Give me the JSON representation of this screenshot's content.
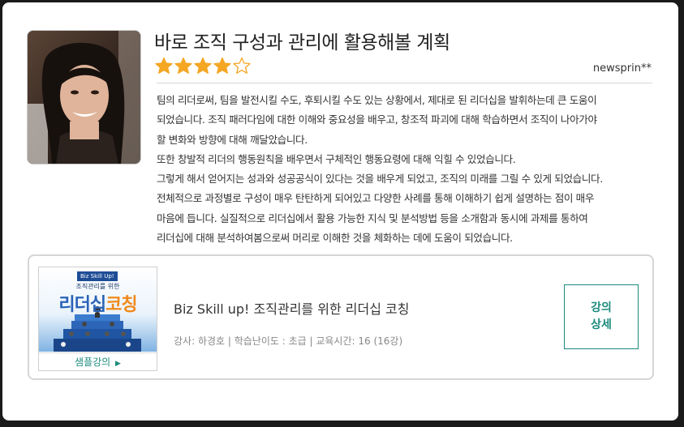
{
  "review": {
    "title": "바로 조직 구성과 관리에 활용해볼 계획",
    "rating": 4,
    "rating_max": 5,
    "author": "newsprin**",
    "paragraphs": [
      "팀의 리더로써, 팀을 발전시킬 수도, 후퇴시킬 수도 있는 상황에서, 제대로 된 리더십을 발휘하는데 큰 도움이",
      "되었습니다. 조직 패러다임에 대한 이해와 중요성을 배우고, 창조적 파괴에 대해 학습하면서 조직이 나아가야",
      "할 변화와 방향에 대해 깨달았습니다.",
      "또한 창발적 리더의 행동원칙을 배우면서 구체적인 행동요령에 대해 익힐 수 있었습니다.",
      "그렇게 해서 얻어지는 성과와 성공공식이 있다는 것을 배우게 되었고, 조직의 미래를 그릴 수 있게 되었습니다.",
      "전체적으로 과정별로 구성이 매우 탄탄하게 되어있고 다양한 사례를 통해 이해하기 쉽게 설명하는 점이 매우",
      "마음에 듭니다. 실질적으로 리더십에서 활용 가능한 지식 및 분석방법 등을 소개함과 동시에 과제를 통하여",
      "리더십에 대해 분석하여봄으로써 머리로 이해한 것을 체화하는 데에 도움이 되었습니다."
    ]
  },
  "course": {
    "thumb_badge": "Biz Skill Up!",
    "thumb_subtitle": "조직관리를 위한",
    "thumb_title_a": "리더십",
    "thumb_title_b": "코칭",
    "sample_label": "샘플강의",
    "sample_arrow_icon": "play-triangle-icon",
    "title": "Biz Skill up! 조직관리를 위한 리더십 코칭",
    "meta": "강사: 하경호 | 학습난이도 : 초급 | 교육시간: 16 (16강)",
    "detail_label_1": "강의",
    "detail_label_2": "상세"
  },
  "colors": {
    "star": "#f5a623",
    "accent": "#1c8b7d"
  }
}
